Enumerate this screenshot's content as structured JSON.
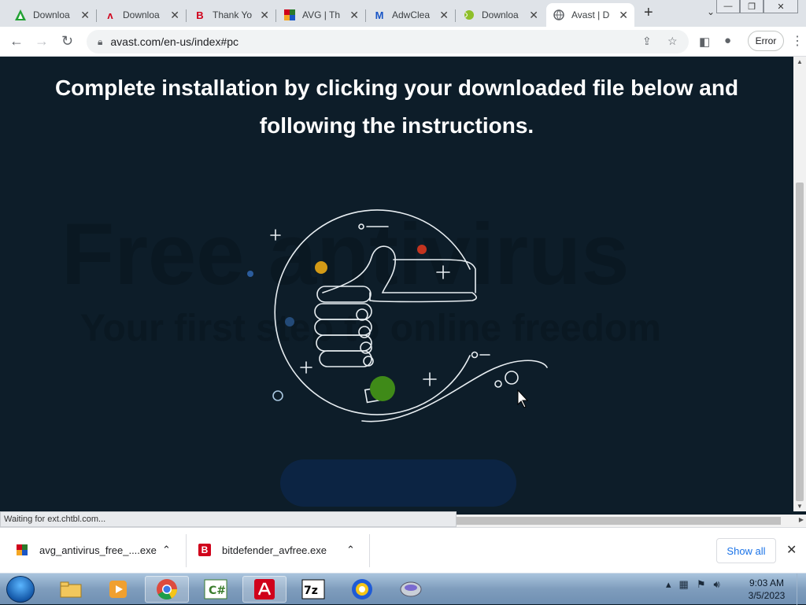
{
  "browser": {
    "tabs": [
      {
        "title": "Downloa",
        "icon": "avast-triangle-icon",
        "color": "#22a134"
      },
      {
        "title": "Downloa",
        "icon": "avira-icon",
        "color": "#d0021b"
      },
      {
        "title": "Thank Yo",
        "icon": "bitdefender-icon",
        "color": "#d0021b"
      },
      {
        "title": "AVG | Th",
        "icon": "avg-icon",
        "color": "#3b7d2b"
      },
      {
        "title": "AdwClea",
        "icon": "malwarebytes-icon",
        "color": "#1a56c6"
      },
      {
        "title": "Downloa",
        "icon": "tennis-ball-icon",
        "color": "#8fbf2a"
      },
      {
        "title": "Avast | D",
        "icon": "globe-icon",
        "color": "#5f6368"
      }
    ],
    "url": "avast.com/en-us/index#pc",
    "error_button": "Error"
  },
  "page": {
    "headline_line1": "Complete installation by clicking your downloaded file below and",
    "headline_line2": "following the instructions.",
    "bg_title": "Free antivirus",
    "bg_subtitle": "Your first step to online freedom"
  },
  "status_text": "Waiting for ext.chtbl.com...",
  "downloads": {
    "items": [
      {
        "name": "avg_antivirus_free_....exe",
        "icon": "avg-icon"
      },
      {
        "name": "bitdefender_avfree.exe",
        "icon": "bitdefender-icon"
      }
    ],
    "show_all": "Show all"
  },
  "taskbar": {
    "apps": [
      "explorer-icon",
      "media-player-icon",
      "chrome-icon",
      "csharp-icon",
      "avira-icon",
      "7zip-icon",
      "vpn-shield-icon",
      "disk-icon"
    ],
    "time": "9:03 AM",
    "date": "3/5/2023"
  }
}
